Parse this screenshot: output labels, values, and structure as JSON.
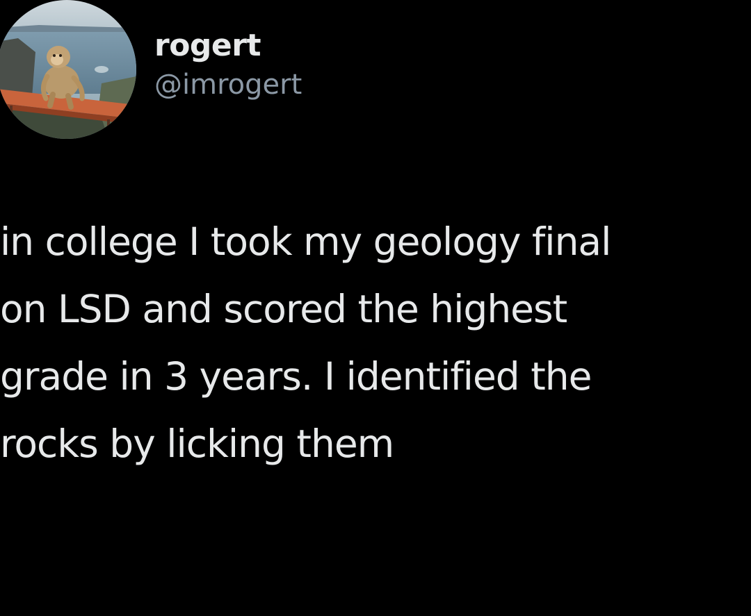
{
  "tweet": {
    "author": {
      "display_name": "rogert",
      "handle": "@imrogert",
      "avatar_icon": "avatar-photo-monkey-on-railing"
    },
    "body_lines": [
      "in college I took my geology final",
      "on LSD and scored the highest",
      "grade in 3 years. I identified the",
      "rocks by licking them"
    ]
  },
  "colors": {
    "background": "#000000",
    "primary_text": "#e7e9ea",
    "secondary_text": "#8b98a5"
  }
}
